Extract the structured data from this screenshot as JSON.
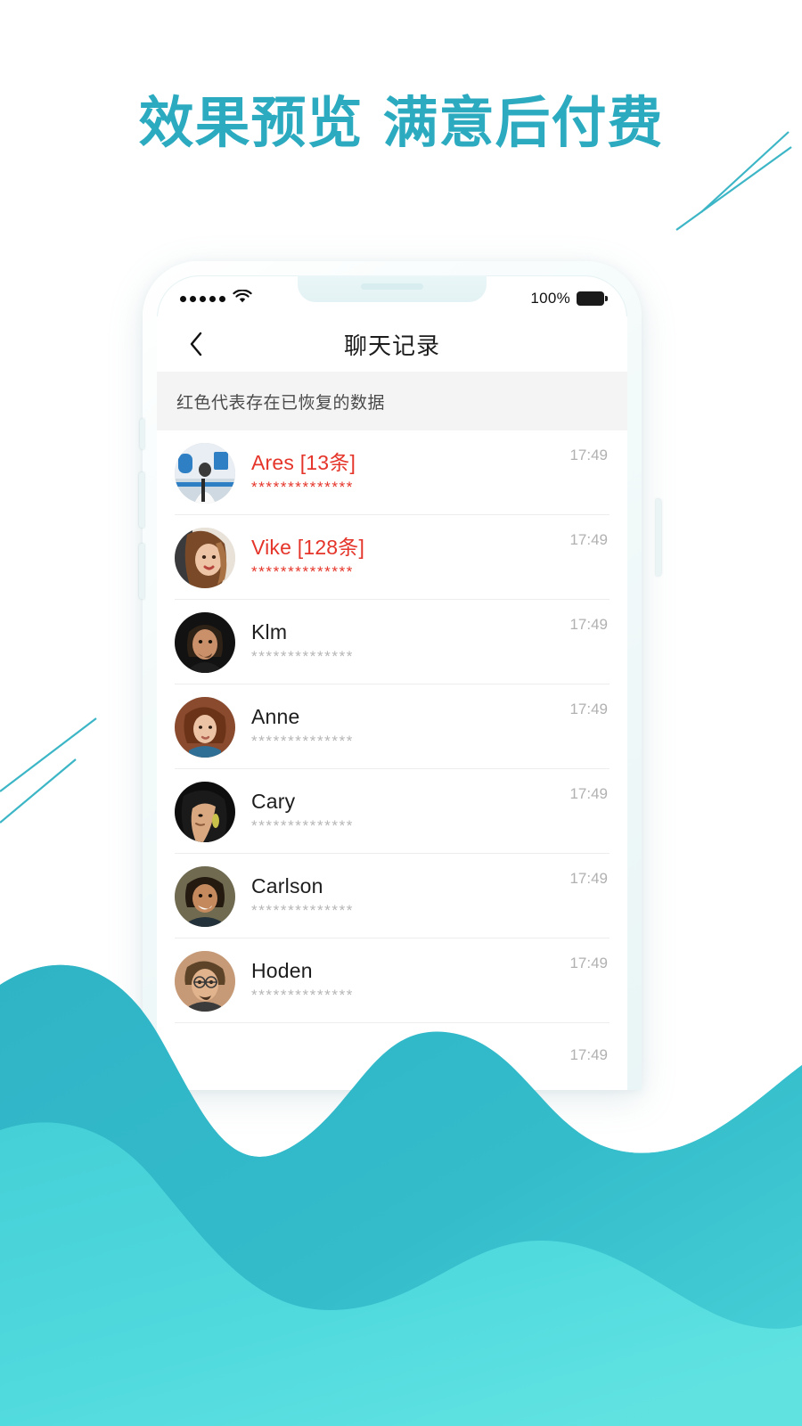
{
  "headline": {
    "part1": "效果预览",
    "part2": "满意后付费",
    "color": "#2cabc0"
  },
  "background": {
    "wave_back_color": "#34b8c8",
    "wave_front_color": "#4fd9dd",
    "decor_line_color": "#3cb6c6"
  },
  "phone": {
    "status_bar": {
      "signal_dots": 5,
      "wifi_icon": "wifi-icon",
      "battery_percent": "100%",
      "battery_icon": "battery-full-icon"
    },
    "nav": {
      "back_icon": "chevron-left-icon",
      "title": "聊天记录"
    },
    "notice": {
      "text": "红色代表存在已恢复的数据",
      "background": "#f4f4f4"
    },
    "list": {
      "recovered_color": "#e5352a",
      "normal_name_color": "#1d1d1d",
      "snippet_mask": "**************",
      "rows": [
        {
          "name": "Ares",
          "count_label": "[13条]",
          "snippet": "**************",
          "time": "17:49",
          "recovered": true,
          "avatar": "avatar-ares"
        },
        {
          "name": "Vike",
          "count_label": "[128条]",
          "snippet": "**************",
          "time": "17:49",
          "recovered": true,
          "avatar": "avatar-vike"
        },
        {
          "name": "Klm",
          "count_label": "",
          "snippet": "**************",
          "time": "17:49",
          "recovered": false,
          "avatar": "avatar-klm"
        },
        {
          "name": "Anne",
          "count_label": "",
          "snippet": "**************",
          "time": "17:49",
          "recovered": false,
          "avatar": "avatar-anne"
        },
        {
          "name": "Cary",
          "count_label": "",
          "snippet": "**************",
          "time": "17:49",
          "recovered": false,
          "avatar": "avatar-cary"
        },
        {
          "name": "Carlson",
          "count_label": "",
          "snippet": "**************",
          "time": "17:49",
          "recovered": false,
          "avatar": "avatar-carlson"
        },
        {
          "name": "Hoden",
          "count_label": "",
          "snippet": "**************",
          "time": "17:49",
          "recovered": false,
          "avatar": "avatar-hoden"
        },
        {
          "name": "",
          "count_label": "",
          "snippet": "",
          "time": "17:49",
          "recovered": false,
          "avatar": ""
        }
      ]
    }
  }
}
